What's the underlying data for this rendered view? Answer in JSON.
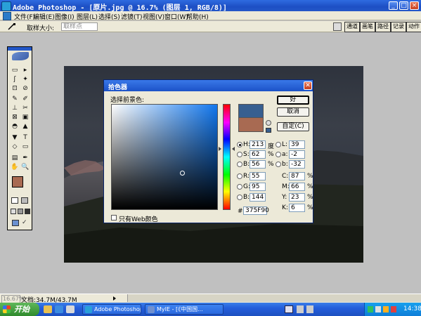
{
  "window": {
    "title": "Adobe Photoshop - [原片.jpg @ 16.7% (图层 1, RGB/8)]",
    "controls": [
      "_",
      "□",
      "×"
    ]
  },
  "menu": {
    "items": [
      "文件(F)",
      "编辑(E)",
      "图像(I)",
      "图层(L)",
      "选择(S)",
      "滤镜(T)",
      "视图(V)",
      "窗口(W)",
      "帮助(H)"
    ]
  },
  "options": {
    "sample_size_label": "取样大小:",
    "sample_size_value": "取样点",
    "palette_tabs": [
      "通道",
      "画笔",
      "路径",
      "记录",
      "动作"
    ]
  },
  "toolbox": {
    "tools": [
      "▭",
      "▸",
      "ʃ",
      "✦",
      "⊡",
      "⊘",
      "✎",
      "✐",
      "⊥",
      "✂",
      "⊠",
      "▣",
      "◓",
      "▲",
      "▼",
      "●",
      "▸",
      "T",
      "◇",
      "▭",
      "▤",
      "✒",
      "✋",
      "🔍"
    ]
  },
  "color_picker": {
    "title": "拾色器",
    "label": "选择前景色:",
    "buttons": {
      "ok": "好",
      "cancel": "取消",
      "custom": "自定(C)"
    },
    "hsb": [
      {
        "label": "H:",
        "value": "213",
        "unit": "度",
        "selected": true
      },
      {
        "label": "S:",
        "value": "62",
        "unit": "%",
        "selected": false
      },
      {
        "label": "B:",
        "value": "56",
        "unit": "%",
        "selected": false
      }
    ],
    "lab": [
      {
        "label": "L:",
        "value": "39"
      },
      {
        "label": "a:",
        "value": "-2"
      },
      {
        "label": "b:",
        "value": "-32"
      }
    ],
    "rgb": [
      {
        "label": "R:",
        "value": "55"
      },
      {
        "label": "G:",
        "value": "95"
      },
      {
        "label": "B:",
        "value": "144"
      }
    ],
    "cmyk": [
      {
        "label": "C:",
        "value": "87",
        "unit": "%"
      },
      {
        "label": "M:",
        "value": "66",
        "unit": "%"
      },
      {
        "label": "Y:",
        "value": "23",
        "unit": "%"
      },
      {
        "label": "K:",
        "value": "6",
        "unit": "%"
      }
    ],
    "hex_label": "#",
    "hex_value": "375F90",
    "web_only_label": "只有Web颜色",
    "new_color": "#375f90",
    "current_color": "#a86a52"
  },
  "status": {
    "zoom": "16.67%",
    "doc": "文档:34.7M/43.7M"
  },
  "taskbar": {
    "start": "开始",
    "tasks": [
      "Adobe Photoshop ...",
      "MyIE - [《中国国..."
    ],
    "clock": "14:38"
  }
}
